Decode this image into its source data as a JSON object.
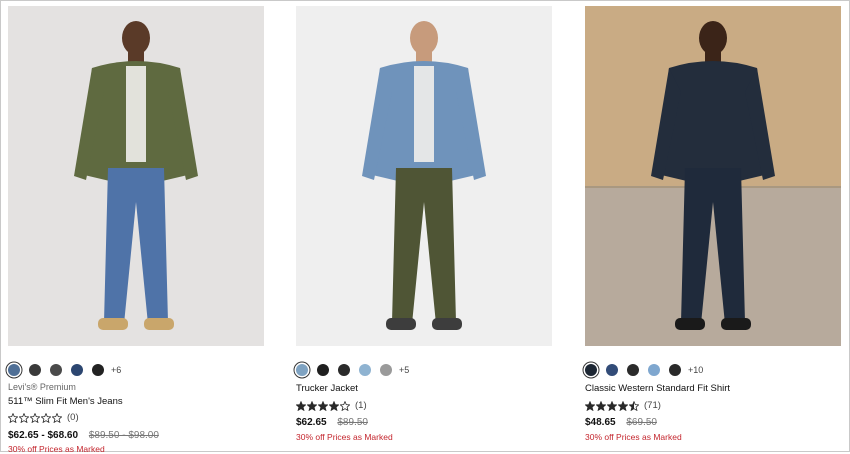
{
  "products": [
    {
      "brand": "Levi's® Premium",
      "name": "511™ Slim Fit Men's Jeans",
      "rating": 0,
      "review_count": "(0)",
      "price": "$62.65 - $68.60",
      "original_price": "$89.50 - $98.00",
      "promo": "30% off Prices as Marked",
      "swatches": [
        "#4f6f96",
        "#3a3a3a",
        "#4a4a4a",
        "#2c4670",
        "#222222"
      ],
      "selected_swatch": 0,
      "more_colors": "+6",
      "photo": {
        "background": "#e4e2e1",
        "top": "#5f6a40",
        "bottom": "#4f73a8",
        "shoes": "#c9a66b",
        "skin": "#5a3a28"
      }
    },
    {
      "brand": "",
      "name": "Trucker Jacket",
      "rating": 4,
      "review_count": "(1)",
      "price": "$62.65",
      "original_price": "$89.50",
      "promo": "30% off Prices as Marked",
      "swatches": [
        "#7fa3c2",
        "#1f1f1f",
        "#2a2a2a",
        "#8fb3d1",
        "#9a9a9a"
      ],
      "selected_swatch": 0,
      "more_colors": "+5",
      "photo": {
        "background": "#efefef",
        "top": "#6f93bb",
        "bottom": "#4f5535",
        "shoes": "#3d3d3d",
        "skin": "#c79b7c"
      }
    },
    {
      "brand": "",
      "name": "Classic Western Standard Fit Shirt",
      "rating": 4.5,
      "review_count": "(71)",
      "price": "$48.65",
      "original_price": "$69.50",
      "promo": "30% off Prices as Marked",
      "swatches": [
        "#1c2633",
        "#324c78",
        "#2b2b2b",
        "#7fa7cf",
        "#2a2a2a"
      ],
      "selected_swatch": 0,
      "more_colors": "+10",
      "photo": {
        "background": "#c9ab84",
        "top": "#232d3c",
        "bottom": "#1f2a3b",
        "shoes": "#1a1a1a",
        "skin": "#3b2418"
      }
    }
  ]
}
